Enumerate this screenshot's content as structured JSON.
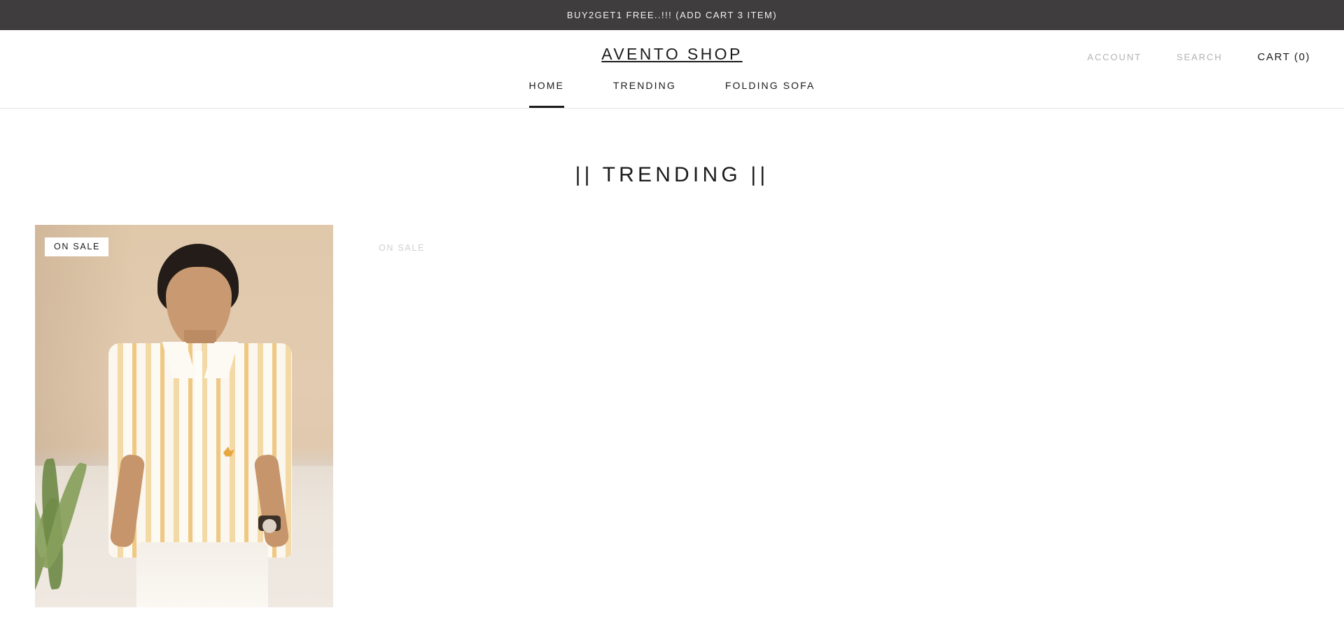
{
  "announcement": {
    "text": "BUY2GET1 FREE..!!! (ADD CART 3 ITEM)",
    "background": "#3f3d3e",
    "color": "#f2f0f0"
  },
  "header": {
    "logo": "AVENTO SHOP",
    "utils": [
      {
        "label": "ACCOUNT",
        "name": "account-link",
        "style": "muted"
      },
      {
        "label": "SEARCH",
        "name": "search-link",
        "style": "muted"
      },
      {
        "label": "CART (0)",
        "name": "cart-link",
        "style": "dark"
      }
    ],
    "cart_count": 0,
    "nav": [
      {
        "label": "HOME",
        "active": true
      },
      {
        "label": "TRENDING",
        "active": false
      },
      {
        "label": "FOLDING SOFA",
        "active": false
      }
    ],
    "border_color": "#e3e3e3",
    "accent": "#1c1b1b"
  },
  "collection": {
    "title": "|| TRENDING ||",
    "products": [
      {
        "badge": "ON SALE",
        "loaded": true,
        "alt": "man-in-striped-shirt-product-photo"
      },
      {
        "badge": "ON SALE",
        "loaded": false,
        "alt": "unloaded-product-photo"
      }
    ]
  }
}
